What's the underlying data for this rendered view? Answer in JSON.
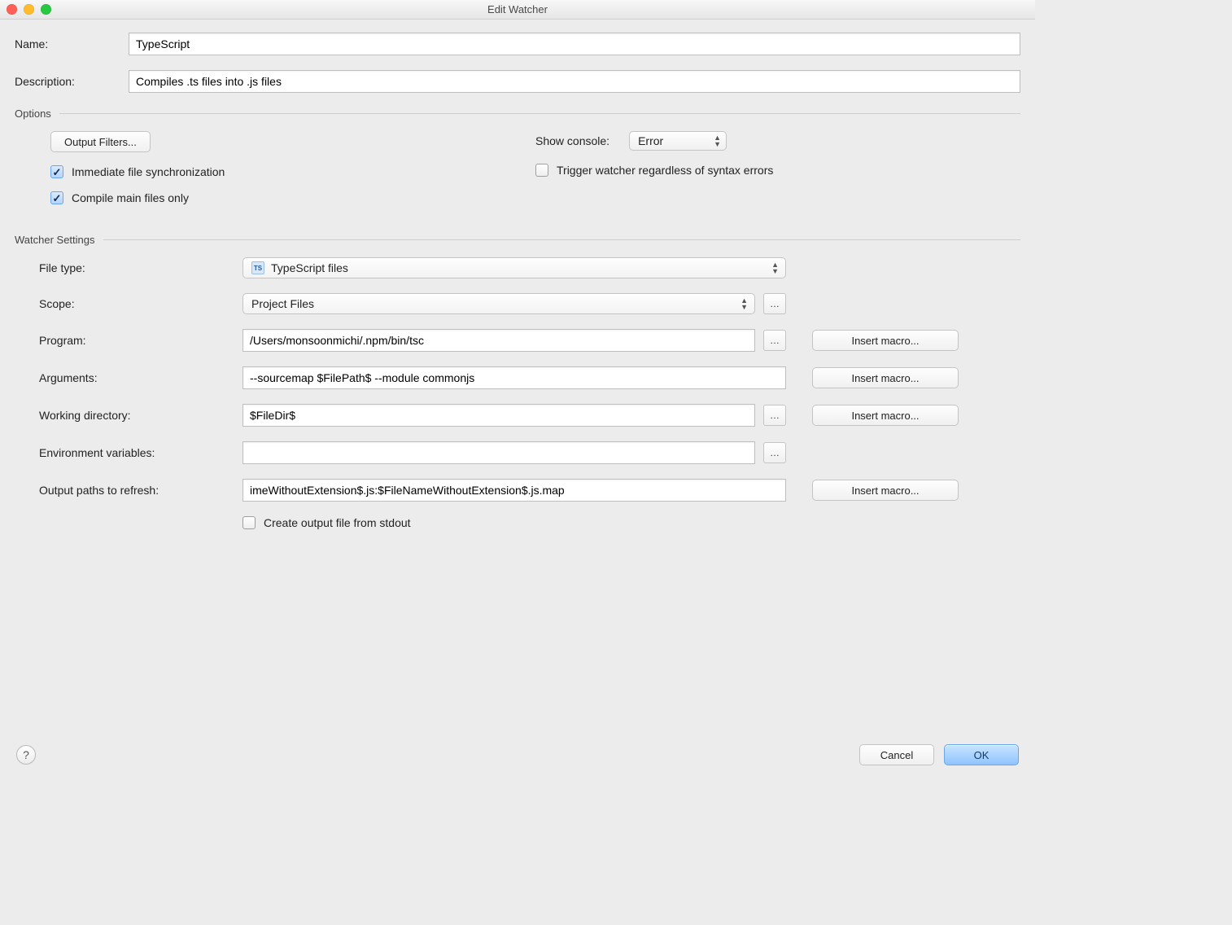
{
  "window": {
    "title": "Edit Watcher"
  },
  "header": {
    "name_label": "Name:",
    "name_value": "TypeScript",
    "desc_label": "Description:",
    "desc_value": "Compiles .ts files into .js files"
  },
  "options": {
    "section": "Options",
    "output_filters": "Output Filters...",
    "show_console_label": "Show console:",
    "show_console_value": "Error",
    "immediate_sync": "Immediate file synchronization",
    "trigger_regardless": "Trigger watcher regardless of syntax errors",
    "compile_main": "Compile main files only",
    "immediate_sync_checked": true,
    "trigger_regardless_checked": false,
    "compile_main_checked": true
  },
  "settings": {
    "section": "Watcher Settings",
    "file_type_label": "File type:",
    "file_type_value": "TypeScript files",
    "scope_label": "Scope:",
    "scope_value": "Project Files",
    "program_label": "Program:",
    "program_value": "/Users/monsoonmichi/.npm/bin/tsc",
    "arguments_label": "Arguments:",
    "arguments_value": "--sourcemap $FilePath$ --module commonjs",
    "working_dir_label": "Working directory:",
    "working_dir_value": "$FileDir$",
    "env_label": "Environment variables:",
    "env_value": "",
    "output_paths_label": "Output paths to refresh:",
    "output_paths_value": "imeWithoutExtension$.js:$FileNameWithoutExtension$.js.map",
    "create_output_stdout": "Create output file from stdout",
    "create_output_stdout_checked": false,
    "insert_macro": "Insert macro..."
  },
  "footer": {
    "cancel": "Cancel",
    "ok": "OK"
  }
}
